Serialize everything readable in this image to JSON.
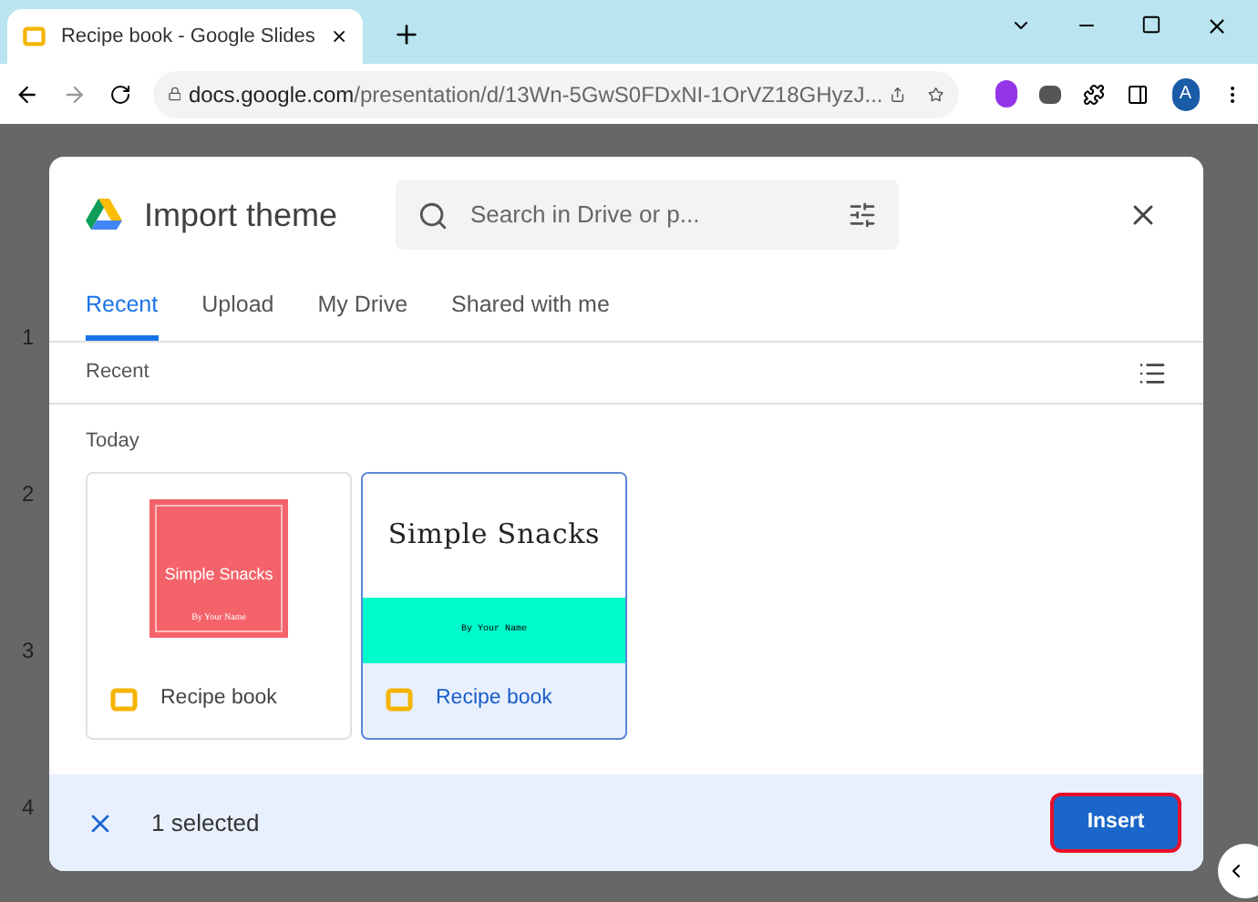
{
  "browser": {
    "tab_title": "Recipe book - Google Slides",
    "url_domain": "docs.google.com",
    "url_path": "/presentation/d/13Wn-5GwS0FDxNI-1OrVZ18GHyzJ...",
    "profile_initial": "A"
  },
  "slide_numbers": [
    "1",
    "2",
    "3",
    "4"
  ],
  "dialog": {
    "title": "Import theme",
    "search": {
      "placeholder": "Search in Drive or p..."
    },
    "tabs": [
      {
        "label": "Recent",
        "selected": true
      },
      {
        "label": "Upload",
        "selected": false
      },
      {
        "label": "My Drive",
        "selected": false
      },
      {
        "label": "Shared with me",
        "selected": false
      }
    ],
    "section_label": "Recent",
    "group_label": "Today",
    "files": [
      {
        "name": "Recipe book",
        "selected": false,
        "thumbnail": {
          "kind": "coral",
          "title": "Simple Snacks",
          "subtitle": "By Your Name"
        }
      },
      {
        "name": "Recipe book",
        "selected": true,
        "thumbnail": {
          "kind": "mint",
          "title": "Simple Snacks",
          "subtitle": "By Your Name"
        }
      }
    ],
    "footer": {
      "selection_text": "1 selected",
      "insert_label": "Insert"
    }
  }
}
